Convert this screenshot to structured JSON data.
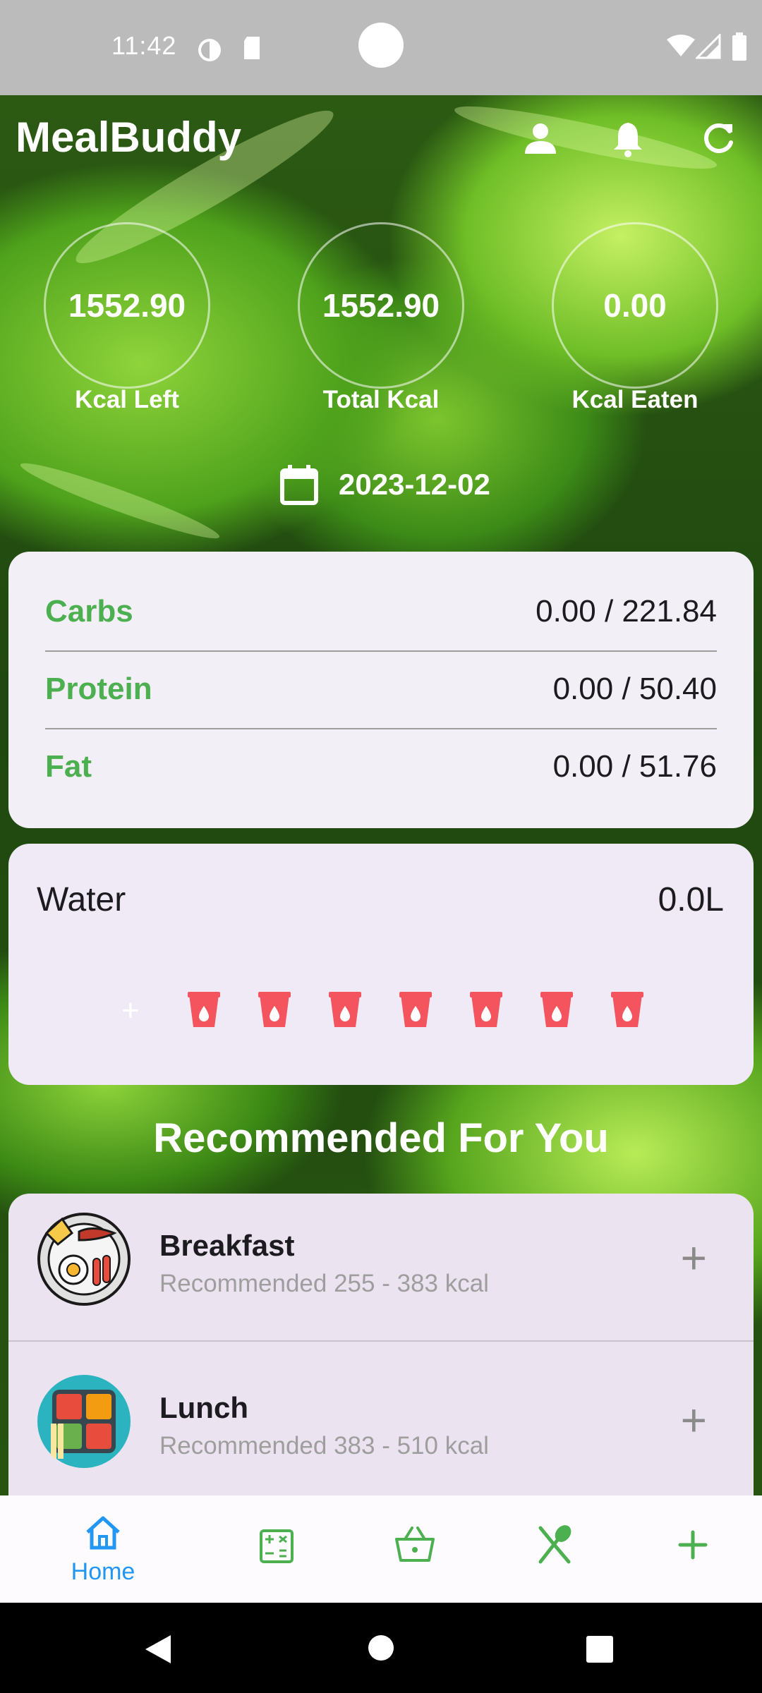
{
  "status_bar": {
    "time": "11:42"
  },
  "header": {
    "title": "MealBuddy"
  },
  "stats": [
    {
      "value": "1552.90",
      "label": "Kcal Left"
    },
    {
      "value": "1552.90",
      "label": "Total Kcal"
    },
    {
      "value": "0.00",
      "label": "Kcal Eaten"
    }
  ],
  "date": "2023-12-02",
  "macros": [
    {
      "name": "Carbs",
      "value": "0.00 / 221.84"
    },
    {
      "name": "Protein",
      "value": "0.00 / 50.40"
    },
    {
      "name": "Fat",
      "value": "0.00 / 51.76"
    }
  ],
  "water": {
    "title": "Water",
    "amount": "0.0L",
    "add_symbol": "+",
    "cups_count": 7
  },
  "recommended": {
    "title": "Recommended For You",
    "meals": [
      {
        "name": "Breakfast",
        "subtitle": "Recommended 255 - 383 kcal",
        "add_symbol": "+"
      },
      {
        "name": "Lunch",
        "subtitle": "Recommended 383 - 510 kcal",
        "add_symbol": "+"
      }
    ]
  },
  "nav": {
    "home_label": "Home"
  },
  "colors": {
    "accent_green": "#4caf50",
    "nav_blue": "#2196f3",
    "cup_red": "#f4545d",
    "card_bg": "#f3eff6"
  }
}
